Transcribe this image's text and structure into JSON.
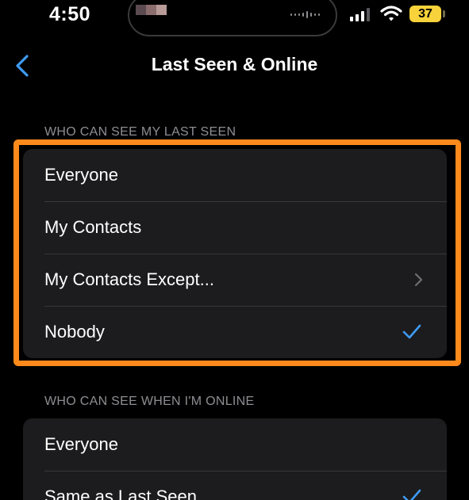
{
  "status_bar": {
    "time": "4:50",
    "battery": "37",
    "battery_color": "#f7d23a"
  },
  "nav": {
    "back_icon": "chevron-left-icon",
    "title": "Last Seen & Online"
  },
  "last_seen": {
    "header": "WHO CAN SEE MY LAST SEEN",
    "options": [
      "Everyone",
      "My Contacts",
      "My Contacts Except...",
      "Nobody"
    ],
    "selected": "Nobody"
  },
  "online": {
    "header": "WHO CAN SEE WHEN I'M ONLINE",
    "options": [
      "Everyone",
      "Same as Last Seen"
    ],
    "selected": "Same as Last Seen"
  },
  "colors": {
    "accent": "#3e9bf5",
    "highlight_border": "#ff8a1c",
    "group_bg": "#1c1c1e",
    "section_header": "#8e8e93"
  }
}
